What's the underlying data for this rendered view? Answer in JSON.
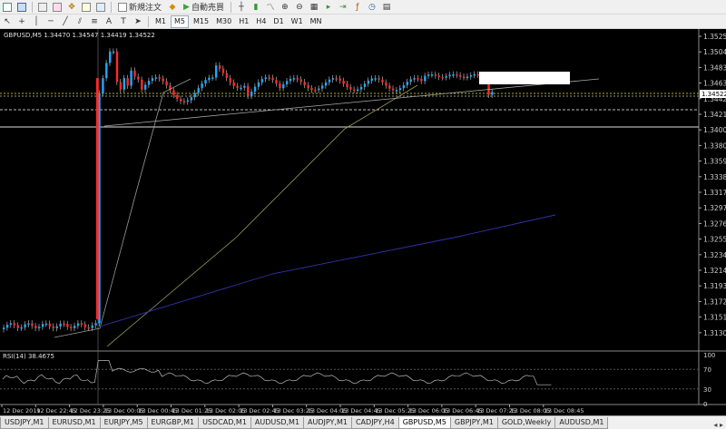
{
  "toolbar": {
    "new_order_label": "新規注文",
    "autotrade_label": "自動売買",
    "timeframes": [
      "M1",
      "M5",
      "M15",
      "M30",
      "H1",
      "H4",
      "D1",
      "W1",
      "MN"
    ],
    "active_timeframe": "M5"
  },
  "chart": {
    "info": "GBPUSD,M5  1.34470 1.34547 1.34419 1.34522",
    "current_price": "1.34522",
    "price_ticks": [
      "1.35250",
      "1.35045",
      "1.34835",
      "1.34630",
      "1.34420",
      "1.34210",
      "1.34005",
      "1.33800",
      "1.33590",
      "1.33385",
      "1.33175",
      "1.32970",
      "1.32760",
      "1.32555",
      "1.32345",
      "1.32140",
      "1.31930",
      "1.31720",
      "1.31515",
      "1.31305"
    ],
    "time_ticks": [
      "12 Dec 2019",
      "12 Dec 22:45",
      "12 Dec 23:25",
      "13 Dec 00:05",
      "13 Dec 00:45",
      "13 Dec 01:25",
      "13 Dec 02:05",
      "13 Dec 02:45",
      "13 Dec 03:25",
      "13 Dec 04:05",
      "13 Dec 04:45",
      "13 Dec 05:25",
      "13 Dec 06:05",
      "13 Dec 06:45",
      "13 Dec 07:25",
      "13 Dec 08:05",
      "13 Dec 08:45"
    ],
    "rsi_label": "RSI(14) 38.4675",
    "rsi_ticks": [
      "100",
      "70",
      "30",
      "0"
    ],
    "colors": {
      "bull": "#1ea8ff",
      "bear": "#ff2a2a",
      "bg": "#000000",
      "grid": "#333333",
      "price_line": "#b8b800"
    }
  },
  "tabs": [
    {
      "label": "USDJPY,M1"
    },
    {
      "label": "EURUSD,M1"
    },
    {
      "label": "EURJPY,M5"
    },
    {
      "label": "EURGBP,M1"
    },
    {
      "label": "USDCAD,M1"
    },
    {
      "label": "AUDUSD,M1"
    },
    {
      "label": "AUDJPY,M1"
    },
    {
      "label": "CADJPY,H4"
    },
    {
      "label": "GBPUSD,M5"
    },
    {
      "label": "GBPJPY,M1"
    },
    {
      "label": "GOLD,Weekly"
    },
    {
      "label": "AUDUSD,M1"
    }
  ],
  "active_tab": "GBPUSD,M5",
  "icons": [
    "new-chart-icon",
    "profiles-icon",
    "market-watch-icon",
    "data-window-icon",
    "navigator-icon",
    "terminal-icon",
    "tester-icon",
    "new-order-icon",
    "metaeditor-icon",
    "autotrading-icon",
    "buy-sell-icon",
    "bar-chart-icon",
    "candlestick-icon",
    "line-chart-icon",
    "zoom-in-icon",
    "zoom-out-icon",
    "tile-icon",
    "autoscroll-icon",
    "chart-shift-icon",
    "indicators-icon",
    "periods-icon",
    "templates-icon",
    "cursor-icon",
    "crosshair-icon",
    "vertical-line-icon",
    "horizontal-line-icon",
    "trendline-icon",
    "channel-icon",
    "fibonacci-icon",
    "text-icon",
    "label-icon",
    "arrows-icon"
  ]
}
